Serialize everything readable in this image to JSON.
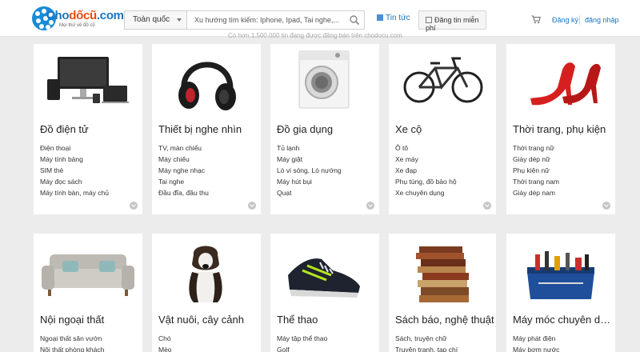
{
  "header": {
    "logo_text_prefix": "Cho",
    "logo_text_main": "dốcũ",
    "logo_text_suffix": ".com",
    "logo_tagline": "Mọi thứ về đồ cũ",
    "region": "Toàn quốc",
    "search_placeholder": "Xu hướng tìm kiếm: Iphone, Ipad, Tai nghe,...",
    "news": "Tin tức",
    "post_button": "Đăng tin miễn phí",
    "register": "Đăng ký",
    "login": "đăng nhập"
  },
  "subline": "Có hơn 1.500.000 tin đang được đăng bán trên chodocu.com",
  "categories": [
    {
      "title": "Đồ điện tử",
      "items": [
        "Điện thoại",
        "Máy tính bảng",
        "SIM thẻ",
        "Máy đọc sách",
        "Máy tính bàn, máy chủ"
      ],
      "icon": "electronics-icon"
    },
    {
      "title": "Thiết bị nghe nhìn",
      "items": [
        "TV, màn chiếu",
        "Máy chiếu",
        "Máy nghe nhạc",
        "Tai nghe",
        "Đầu đĩa, đầu thu"
      ],
      "icon": "headphones-icon"
    },
    {
      "title": "Đồ gia dụng",
      "items": [
        "Tủ lạnh",
        "Máy giặt",
        "Lò vi sóng, Lò nướng",
        "Máy hút bụi",
        "Quạt"
      ],
      "icon": "washing-machine-icon"
    },
    {
      "title": "Xe cộ",
      "items": [
        "Ô tô",
        "Xe máy",
        "Xe đạp",
        "Phụ tùng, đồ bảo hộ",
        "Xe chuyên dụng"
      ],
      "icon": "bicycle-icon"
    },
    {
      "title": "Thời trang, phụ kiện",
      "items": [
        "Thời trang nữ",
        "Giày dép nữ",
        "Phụ kiện nữ",
        "Thời trang nam",
        "Giày dép nam"
      ],
      "icon": "high-heel-icon"
    },
    {
      "title": "Nội ngoại thất",
      "items": [
        "Ngoại thất sân vườn",
        "Nội thất phòng khách"
      ],
      "icon": "sofa-icon"
    },
    {
      "title": "Vật nuôi, cây cảnh",
      "items": [
        "Chó",
        "Mèo"
      ],
      "icon": "dog-icon"
    },
    {
      "title": "Thể thao",
      "items": [
        "Máy tập thể thao",
        "Golf"
      ],
      "icon": "sneaker-icon"
    },
    {
      "title": "Sách báo, nghệ thuật",
      "items": [
        "Sách, truyện chữ",
        "Truyện tranh, tạp chí"
      ],
      "icon": "books-icon"
    },
    {
      "title": "Máy móc chuyên dụng",
      "items": [
        "Máy phát điện",
        "Máy bơm nước"
      ],
      "icon": "toolbag-icon"
    }
  ],
  "colors": {
    "brand_blue": "#1a75c2",
    "logo_orange": "#e84b0e",
    "page_bg": "#ececec"
  }
}
